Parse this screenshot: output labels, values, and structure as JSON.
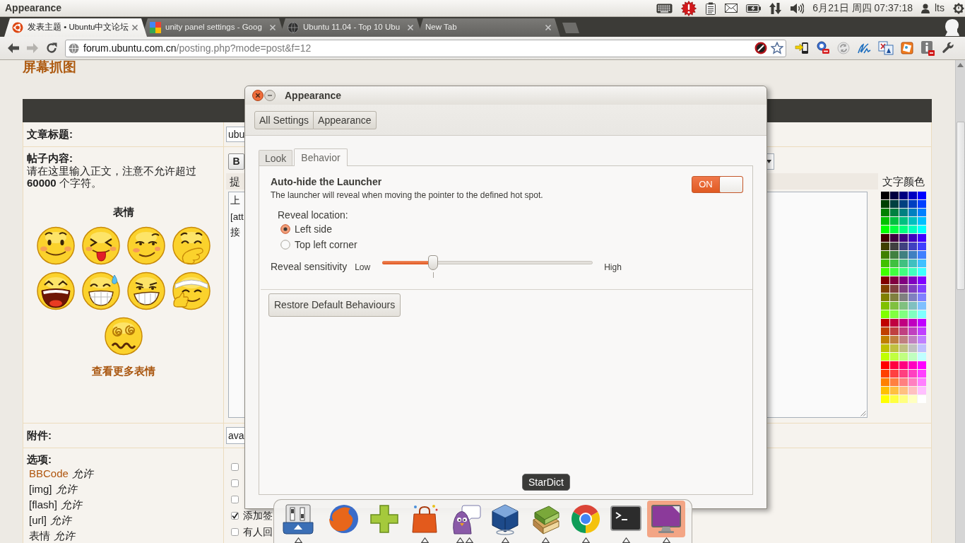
{
  "top_panel": {
    "app_title": "Appearance",
    "clock": "6月21日 周四 07:37:18",
    "user": "lts"
  },
  "browser": {
    "tabs": [
      {
        "title": "发表主题 • Ubuntu中文论坛",
        "selected": true
      },
      {
        "title": "unity panel settings - Goog",
        "selected": false
      },
      {
        "title": "Ubuntu 11.04 - Top 10 Ubu",
        "selected": false
      },
      {
        "title": "New Tab",
        "selected": false
      }
    ],
    "navigation": {
      "back_disabled": false,
      "forward_disabled": true
    },
    "address_bar": {
      "host": "forum.ubuntu.com.cn",
      "path": "/posting.php?mode=post&f=12"
    }
  },
  "page": {
    "heading": "屏幕抓图",
    "subject": {
      "label": "文章标题:",
      "value": "ubu"
    },
    "content": {
      "label": "帖子内容:",
      "hint_lines": [
        "请在这里输入正文，注意不允许超过",
        "**60000** 个字符。"
      ],
      "emoticons_title": "表情",
      "more_emoticons": "查看更多表情",
      "bold_button": "B",
      "tip_bar": "提",
      "text_lines": [
        "上",
        "[att",
        "接"
      ],
      "palette_title": "文字颜色",
      "palette": [
        {
          "color": "#000000"
        },
        {
          "color": "#000040"
        },
        {
          "color": "#000080"
        },
        {
          "color": "#0000c0"
        },
        {
          "color": "#0000ff"
        },
        {
          "color": "#004000"
        },
        {
          "color": "#004040"
        },
        {
          "color": "#004080"
        },
        {
          "color": "#0040c0"
        },
        {
          "color": "#0040ff"
        },
        {
          "color": "#008000"
        },
        {
          "color": "#008040"
        },
        {
          "color": "#008080"
        },
        {
          "color": "#0080c0"
        },
        {
          "color": "#0080ff"
        },
        {
          "color": "#00c000"
        },
        {
          "color": "#00c040"
        },
        {
          "color": "#00c080"
        },
        {
          "color": "#00c0c0"
        },
        {
          "color": "#00c0ff"
        },
        {
          "color": "#00ff00"
        },
        {
          "color": "#00ff40"
        },
        {
          "color": "#00ff80"
        },
        {
          "color": "#00ffc0"
        },
        {
          "color": "#00ffff"
        },
        {
          "color": "#400000"
        },
        {
          "color": "#400040"
        },
        {
          "color": "#400080"
        },
        {
          "color": "#4000c0"
        },
        {
          "color": "#4000ff"
        },
        {
          "color": "#404000"
        },
        {
          "color": "#404040"
        },
        {
          "color": "#404080"
        },
        {
          "color": "#4040c0"
        },
        {
          "color": "#4040ff"
        },
        {
          "color": "#408000"
        },
        {
          "color": "#408040"
        },
        {
          "color": "#408080"
        },
        {
          "color": "#4080c0"
        },
        {
          "color": "#4080ff"
        },
        {
          "color": "#40c000"
        },
        {
          "color": "#40c040"
        },
        {
          "color": "#40c080"
        },
        {
          "color": "#40c0c0"
        },
        {
          "color": "#40c0ff"
        },
        {
          "color": "#40ff00"
        },
        {
          "color": "#40ff40"
        },
        {
          "color": "#40ff80"
        },
        {
          "color": "#40ffc0"
        },
        {
          "color": "#40ffff"
        },
        {
          "color": "#800000"
        },
        {
          "color": "#800040"
        },
        {
          "color": "#800080"
        },
        {
          "color": "#8000c0"
        },
        {
          "color": "#8000ff"
        },
        {
          "color": "#804000"
        },
        {
          "color": "#804040"
        },
        {
          "color": "#804080"
        },
        {
          "color": "#8040c0"
        },
        {
          "color": "#8040ff"
        },
        {
          "color": "#808000"
        },
        {
          "color": "#808040"
        },
        {
          "color": "#808080"
        },
        {
          "color": "#8080c0"
        },
        {
          "color": "#8080ff"
        },
        {
          "color": "#80c000"
        },
        {
          "color": "#80c040"
        },
        {
          "color": "#80c080"
        },
        {
          "color": "#80c0c0"
        },
        {
          "color": "#80c0ff"
        },
        {
          "color": "#80ff00"
        },
        {
          "color": "#80ff40"
        },
        {
          "color": "#80ff80"
        },
        {
          "color": "#80ffc0"
        },
        {
          "color": "#80ffff"
        },
        {
          "color": "#c00000"
        },
        {
          "color": "#c00040"
        },
        {
          "color": "#c00080"
        },
        {
          "color": "#c000c0"
        },
        {
          "color": "#c000ff"
        },
        {
          "color": "#c04000"
        },
        {
          "color": "#c04040"
        },
        {
          "color": "#c04080"
        },
        {
          "color": "#c040c0"
        },
        {
          "color": "#c040ff"
        },
        {
          "color": "#c08000"
        },
        {
          "color": "#c08040"
        },
        {
          "color": "#c08080"
        },
        {
          "color": "#c080c0"
        },
        {
          "color": "#c080ff"
        },
        {
          "color": "#c0c000"
        },
        {
          "color": "#c0c040"
        },
        {
          "color": "#c0c080"
        },
        {
          "color": "#c0c0c0"
        },
        {
          "color": "#c0c0ff"
        },
        {
          "color": "#c0ff00"
        },
        {
          "color": "#c0ff40"
        },
        {
          "color": "#c0ff80"
        },
        {
          "color": "#c0ffc0"
        },
        {
          "color": "#c0ffff"
        },
        {
          "color": "#ff0000"
        },
        {
          "color": "#ff0040"
        },
        {
          "color": "#ff0080"
        },
        {
          "color": "#ff00c0"
        },
        {
          "color": "#ff00ff"
        },
        {
          "color": "#ff4000"
        },
        {
          "color": "#ff4040"
        },
        {
          "color": "#ff4080"
        },
        {
          "color": "#ff40c0"
        },
        {
          "color": "#ff40ff"
        },
        {
          "color": "#ff8000"
        },
        {
          "color": "#ff8040"
        },
        {
          "color": "#ff8080"
        },
        {
          "color": "#ff80c0"
        },
        {
          "color": "#ff80ff"
        },
        {
          "color": "#ffc000"
        },
        {
          "color": "#ffc040"
        },
        {
          "color": "#ffc080"
        },
        {
          "color": "#ffc0c0"
        },
        {
          "color": "#ffc0ff"
        },
        {
          "color": "#ffff00"
        },
        {
          "color": "#ffff40"
        },
        {
          "color": "#ffff80"
        },
        {
          "color": "#ffffc0"
        },
        {
          "color": "#ffffff"
        }
      ]
    },
    "attachment": {
      "label": "附件:",
      "value": "ava"
    },
    "options": {
      "label": "选项:",
      "items": [
        {
          "label": "BBCode",
          "link": true,
          "status": "允许"
        },
        {
          "label": "[img]",
          "link": false,
          "status": "允许"
        },
        {
          "label": "[flash]",
          "link": false,
          "status": "允许"
        },
        {
          "label": "[url]",
          "link": false,
          "status": "允许"
        },
        {
          "label": "表情",
          "link": false,
          "status": "允许"
        }
      ],
      "checkboxes": [
        {
          "checked": false
        },
        {
          "checked": false
        },
        {
          "checked": false
        },
        {
          "checked": true,
          "label": "添加签"
        },
        {
          "checked": false,
          "label": "有人回"
        }
      ]
    }
  },
  "dialog": {
    "title": "Appearance",
    "breadcrumbs": [
      "All Settings",
      "Appearance"
    ],
    "tabs": [
      {
        "label": "Look",
        "selected": false
      },
      {
        "label": "Behavior",
        "selected": true
      }
    ],
    "autohide": {
      "title": "Auto-hide the Launcher",
      "description": "The launcher will reveal when moving the pointer to the defined hot spot.",
      "switch_label": "ON",
      "on": true
    },
    "reveal_location": {
      "label": "Reveal location:",
      "options": [
        {
          "label": "Left side",
          "selected": true
        },
        {
          "label": "Top left corner",
          "selected": false
        }
      ]
    },
    "sensitivity": {
      "label": "Reveal sensitivity",
      "low_label": "Low",
      "high_label": "High",
      "level": 0.24
    },
    "restore_button": "Restore Default Behaviours"
  },
  "launcher": {
    "items": [
      {
        "selected": false,
        "running": true,
        "multiple_windows": false
      },
      {
        "selected": false,
        "running": false,
        "multiple_windows": false
      },
      {
        "selected": false,
        "running": false,
        "multiple_windows": false
      },
      {
        "selected": false,
        "running": true,
        "multiple_windows": false
      },
      {
        "selected": false,
        "running": true,
        "multiple_windows": true
      },
      {
        "selected": false,
        "running": true,
        "multiple_windows": false
      },
      {
        "selected": false,
        "running": true,
        "multiple_windows": false
      },
      {
        "selected": false,
        "running": true,
        "multiple_windows": false
      },
      {
        "selected": false,
        "running": true,
        "multiple_windows": false
      },
      {
        "selected": true,
        "running": true,
        "multiple_windows": false
      }
    ],
    "tooltip": "StarDict"
  }
}
